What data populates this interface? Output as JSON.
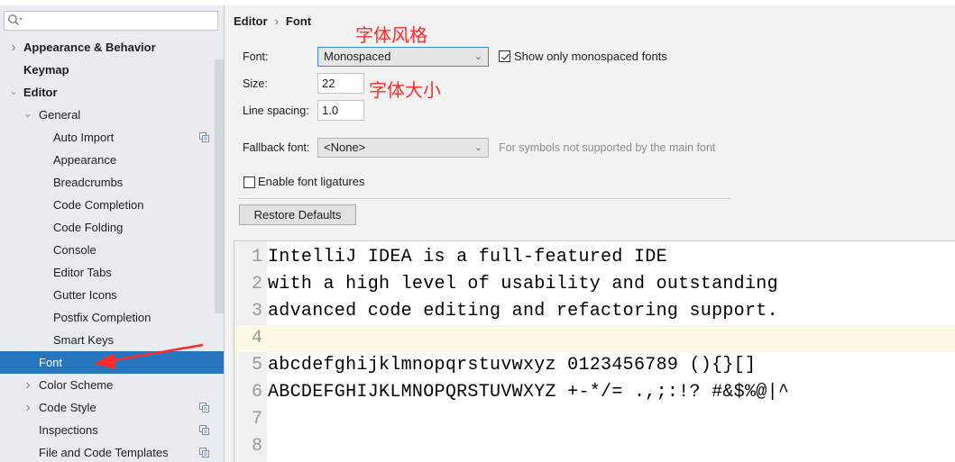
{
  "sidebar": {
    "search_placeholder": "",
    "items": [
      {
        "label": "Appearance & Behavior",
        "level": 0,
        "arrow": "collapsed",
        "bold": true,
        "copy": false
      },
      {
        "label": "Keymap",
        "level": 0,
        "arrow": "none",
        "bold": true,
        "copy": false
      },
      {
        "label": "Editor",
        "level": 0,
        "arrow": "expanded",
        "bold": true,
        "copy": false
      },
      {
        "label": "General",
        "level": 1,
        "arrow": "expanded",
        "bold": false,
        "copy": false
      },
      {
        "label": "Auto Import",
        "level": 2,
        "arrow": "none",
        "bold": false,
        "copy": true
      },
      {
        "label": "Appearance",
        "level": 2,
        "arrow": "none",
        "bold": false,
        "copy": false
      },
      {
        "label": "Breadcrumbs",
        "level": 2,
        "arrow": "none",
        "bold": false,
        "copy": false
      },
      {
        "label": "Code Completion",
        "level": 2,
        "arrow": "none",
        "bold": false,
        "copy": false
      },
      {
        "label": "Code Folding",
        "level": 2,
        "arrow": "none",
        "bold": false,
        "copy": false
      },
      {
        "label": "Console",
        "level": 2,
        "arrow": "none",
        "bold": false,
        "copy": false
      },
      {
        "label": "Editor Tabs",
        "level": 2,
        "arrow": "none",
        "bold": false,
        "copy": false
      },
      {
        "label": "Gutter Icons",
        "level": 2,
        "arrow": "none",
        "bold": false,
        "copy": false
      },
      {
        "label": "Postfix Completion",
        "level": 2,
        "arrow": "none",
        "bold": false,
        "copy": false
      },
      {
        "label": "Smart Keys",
        "level": 2,
        "arrow": "none",
        "bold": false,
        "copy": false
      },
      {
        "label": "Font",
        "level": 1,
        "arrow": "none",
        "bold": false,
        "copy": false,
        "selected": true
      },
      {
        "label": "Color Scheme",
        "level": 1,
        "arrow": "collapsed",
        "bold": false,
        "copy": false
      },
      {
        "label": "Code Style",
        "level": 1,
        "arrow": "collapsed",
        "bold": false,
        "copy": true
      },
      {
        "label": "Inspections",
        "level": 1,
        "arrow": "none",
        "bold": false,
        "copy": true
      },
      {
        "label": "File and Code Templates",
        "level": 1,
        "arrow": "none",
        "bold": false,
        "copy": true
      }
    ]
  },
  "breadcrumb": {
    "parent": "Editor",
    "separator": "›",
    "current": "Font"
  },
  "annotations": {
    "font_style": "字体风格",
    "font_size": "字体大小",
    "arrow_color": "#ff2a2a"
  },
  "form": {
    "font_label": "Font:",
    "font_value": "Monospaced",
    "show_mono_label": "Show only monospaced fonts",
    "show_mono_checked": true,
    "size_label": "Size:",
    "size_value": "22",
    "line_spacing_label": "Line spacing:",
    "line_spacing_value": "1.0",
    "fallback_label": "Fallback font:",
    "fallback_value": "<None>",
    "fallback_hint": "For symbols not supported by the main font",
    "ligatures_label": "Enable font ligatures",
    "ligatures_checked": false,
    "restore_label": "Restore Defaults"
  },
  "preview": {
    "current_line": 4,
    "lines": [
      {
        "no": "1",
        "text": "IntelliJ IDEA is a full-featured IDE"
      },
      {
        "no": "2",
        "text": "with a high level of usability and outstanding"
      },
      {
        "no": "3",
        "text": "advanced code editing and refactoring support."
      },
      {
        "no": "4",
        "text": ""
      },
      {
        "no": "5",
        "text": "abcdefghijklmnopqrstuvwxyz 0123456789 (){}[]"
      },
      {
        "no": "6",
        "text": "ABCDEFGHIJKLMNOPQRSTUVWXYZ +-*/= .,;:!? #&$%@|^"
      },
      {
        "no": "7",
        "text": ""
      },
      {
        "no": "8",
        "text": ""
      }
    ]
  },
  "colors": {
    "selection": "#2675bf",
    "current_line": "#fdf8e6",
    "accent_border": "#3b88d6"
  }
}
